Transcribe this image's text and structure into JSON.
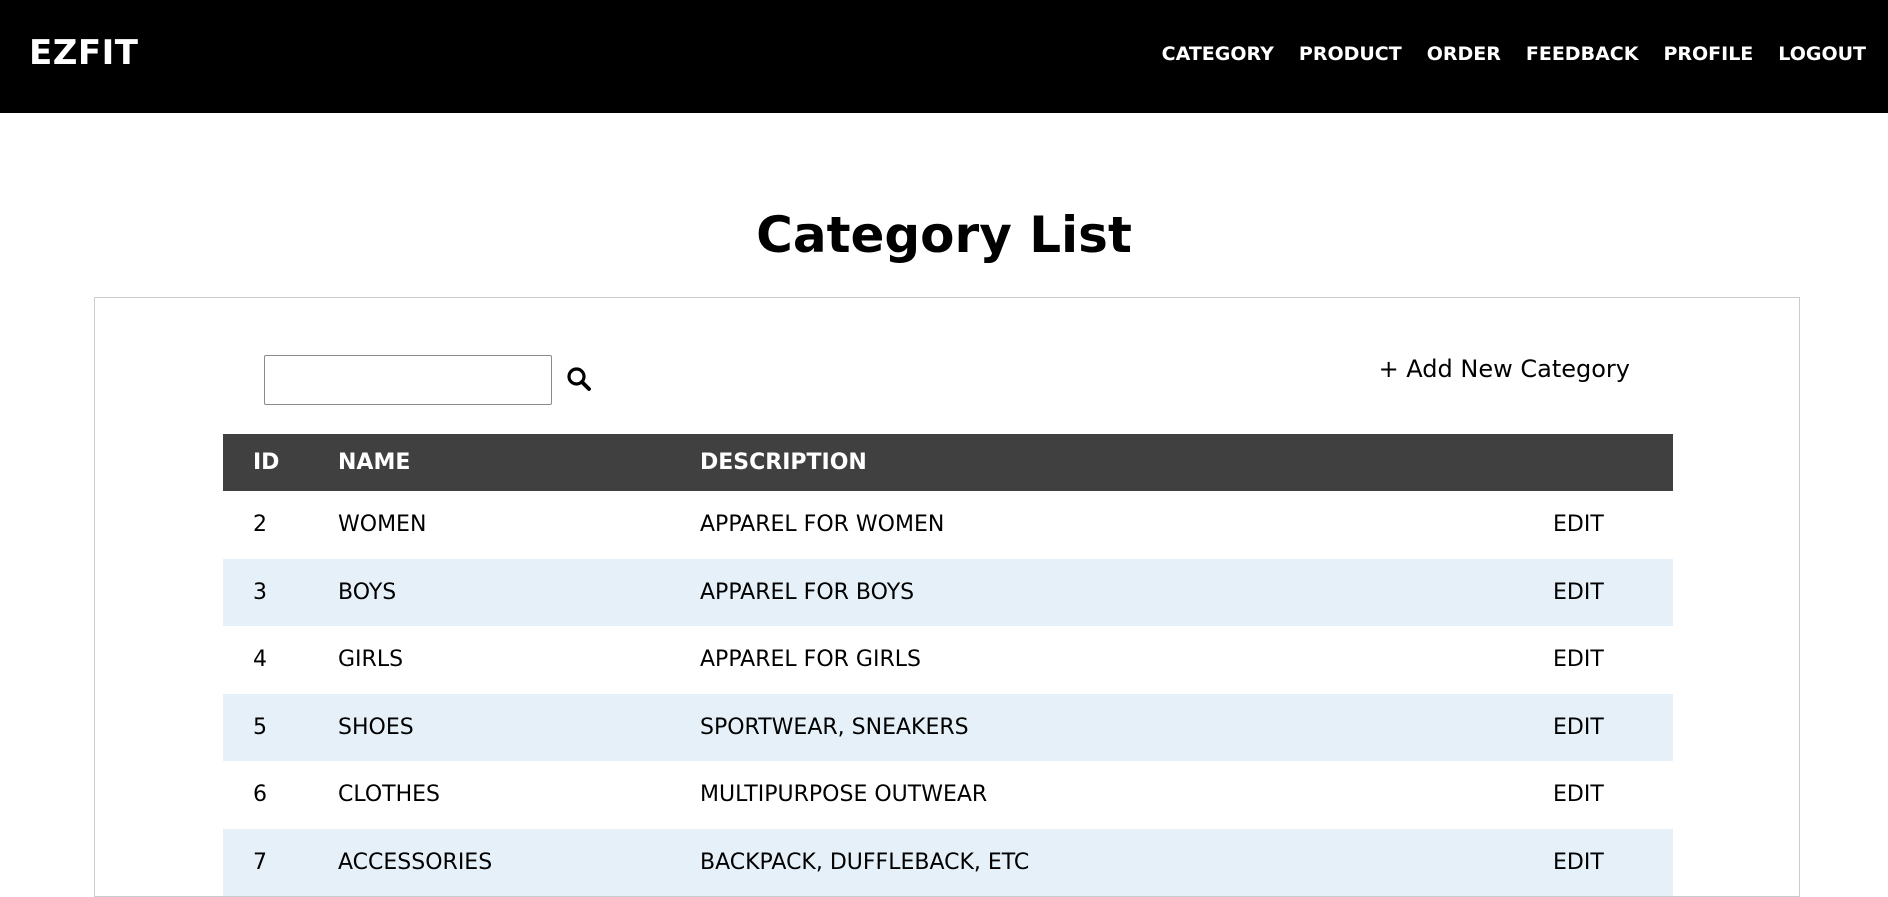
{
  "header": {
    "brand": "EZFIT",
    "nav": [
      "CATEGORY",
      "PRODUCT",
      "ORDER",
      "FEEDBACK",
      "PROFILE",
      "LOGOUT"
    ]
  },
  "page": {
    "title": "Category List"
  },
  "toolbar": {
    "search_value": "",
    "search_placeholder": "",
    "add_label": "+ Add New Category"
  },
  "table": {
    "headers": [
      "ID",
      "NAME",
      "DESCRIPTION",
      ""
    ],
    "rows": [
      {
        "id": "2",
        "name": "WOMEN",
        "description": "APPAREL FOR WOMEN",
        "action": "EDIT"
      },
      {
        "id": "3",
        "name": "BOYS",
        "description": "APPAREL FOR BOYS",
        "action": "EDIT"
      },
      {
        "id": "4",
        "name": "GIRLS",
        "description": "APPAREL FOR GIRLS",
        "action": "EDIT"
      },
      {
        "id": "5",
        "name": "SHOES",
        "description": "SPORTWEAR, SNEAKERS",
        "action": "EDIT"
      },
      {
        "id": "6",
        "name": "CLOTHES",
        "description": "MULTIPURPOSE OUTWEAR",
        "action": "EDIT"
      },
      {
        "id": "7",
        "name": "ACCESSORIES",
        "description": "BACKPACK, DUFFLEBACK, ETC",
        "action": "EDIT"
      }
    ]
  },
  "colors": {
    "topbar": "#000000",
    "table_header": "#404040",
    "row_alt": "#e5f0f8"
  },
  "icons": {
    "search": "search-icon"
  }
}
